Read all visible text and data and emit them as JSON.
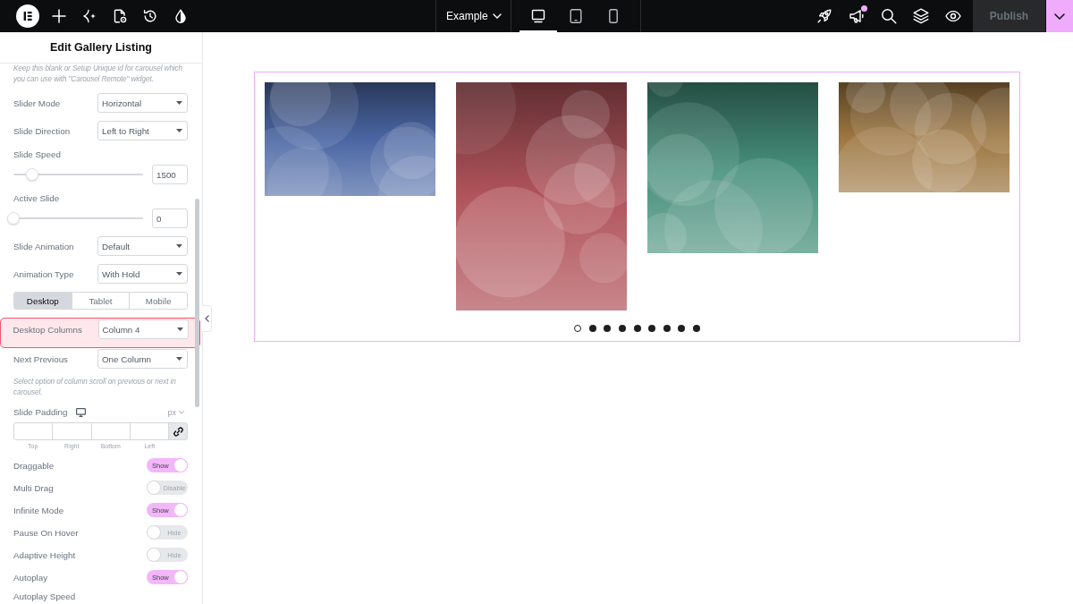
{
  "top_bar": {
    "page_selector": {
      "label": "Example"
    },
    "devices": [
      {
        "kind": "desktop",
        "selected": true
      },
      {
        "kind": "tablet",
        "selected": false
      },
      {
        "kind": "mobile",
        "selected": false
      }
    ],
    "notifications": {
      "unread": true
    },
    "publish": {
      "label": "Publish",
      "disabled": true
    }
  },
  "panel": {
    "title": "Edit Gallery Listing",
    "controls": [
      {
        "kind": "note",
        "text": "Keep this blank or Setup Unique id for carousel which you can use with \"Carousel Remote\" widget.",
        "highlighted": false
      },
      {
        "kind": "select",
        "label": "Slider Mode",
        "value": "Horizontal",
        "highlighted": false
      },
      {
        "kind": "select",
        "label": "Slide Direction",
        "value": "Left to Right",
        "highlighted": false
      },
      {
        "kind": "slider",
        "label": "Slide Speed",
        "level": 0.145,
        "value": "1500",
        "highlighted": false
      },
      {
        "kind": "slider",
        "label": "Active Slide",
        "level": 0,
        "value": "0",
        "highlighted": false
      },
      {
        "kind": "select",
        "label": "Slide Animation",
        "value": "Default",
        "highlighted": false
      },
      {
        "kind": "select",
        "label": "Animation Type",
        "value": "With Hold",
        "highlighted": false
      },
      {
        "kind": "tabs",
        "tabs": [
          {
            "label": "Desktop",
            "selected": true
          },
          {
            "label": "Tablet",
            "selected": false
          },
          {
            "label": "Mobile",
            "selected": false
          }
        ],
        "highlighted": false
      },
      {
        "kind": "select",
        "label": "Desktop Columns",
        "value": "Column 4",
        "highlighted": true
      },
      {
        "kind": "select",
        "label": "Next Previous",
        "value": "One Column",
        "highlighted": false
      },
      {
        "kind": "note",
        "text": "Select option of column scroll on previous or next in carousel.",
        "highlighted": false
      },
      {
        "kind": "dimensions",
        "label": "Slide Padding",
        "unit": "px",
        "fields": [
          {
            "label": "Top"
          },
          {
            "label": "Right"
          },
          {
            "label": "Bottom"
          },
          {
            "label": "Left"
          }
        ],
        "highlighted": false
      },
      {
        "kind": "switch",
        "label": "Draggable",
        "on": true,
        "state_text": "Show",
        "highlighted": false
      },
      {
        "kind": "switch",
        "label": "Multi Drag",
        "on": false,
        "state_text": "Disable",
        "highlighted": false
      },
      {
        "kind": "switch",
        "label": "Infinite Mode",
        "on": true,
        "state_text": "Show",
        "highlighted": false
      },
      {
        "kind": "switch",
        "label": "Pause On Hover",
        "on": false,
        "state_text": "Hide",
        "highlighted": false
      },
      {
        "kind": "switch",
        "label": "Adaptive Height",
        "on": false,
        "state_text": "Hide",
        "highlighted": false
      },
      {
        "kind": "switch",
        "label": "Autoplay",
        "on": true,
        "state_text": "Show",
        "highlighted": false
      },
      {
        "kind": "heading",
        "label": "Autoplay Speed",
        "highlighted": false
      }
    ]
  },
  "carousel": {
    "slides": [
      {
        "kind": "landscape",
        "color": "#4a66a3"
      },
      {
        "kind": "portrait",
        "color": "#b1545b"
      },
      {
        "kind": "square",
        "color": "#458e79"
      },
      {
        "kind": "wide",
        "color": "#9d7641"
      }
    ],
    "dots": [
      {
        "selected": true
      },
      {
        "selected": false
      },
      {
        "selected": false
      },
      {
        "selected": false
      },
      {
        "selected": false
      },
      {
        "selected": false
      },
      {
        "selected": false
      },
      {
        "selected": false
      },
      {
        "selected": false
      }
    ]
  }
}
